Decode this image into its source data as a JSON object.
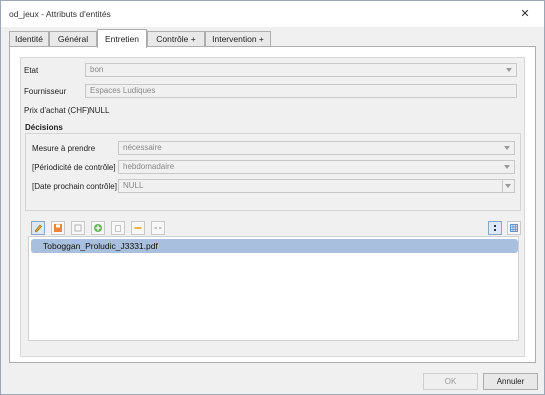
{
  "window": {
    "title": "od_jeux - Attributs d'entités"
  },
  "tabs": [
    {
      "label": "Identité"
    },
    {
      "label": "Général"
    },
    {
      "label": "Entretien"
    },
    {
      "label": "Contrôle +"
    },
    {
      "label": "Intervention +"
    }
  ],
  "form": {
    "etat": {
      "label": "Etat",
      "value": "bon"
    },
    "fournisseur": {
      "label": "Fournisseur",
      "value": "Espaces Ludiques"
    },
    "prix": {
      "label": "Prix d'achat (CHF)",
      "value": "NULL"
    }
  },
  "decisions": {
    "title": "Décisions",
    "mesure": {
      "label": "Mesure à prendre",
      "value": "nécessaire"
    },
    "periodicite": {
      "label": "[Périodicité de contrôle]",
      "value": "hebdomadaire"
    },
    "date": {
      "label": "[Date prochain contrôle]",
      "value": "NULL"
    }
  },
  "attachments": {
    "items": [
      "Toboggan_Proludic_J3331.pdf"
    ]
  },
  "buttons": {
    "ok": "OK",
    "cancel": "Annuler"
  }
}
